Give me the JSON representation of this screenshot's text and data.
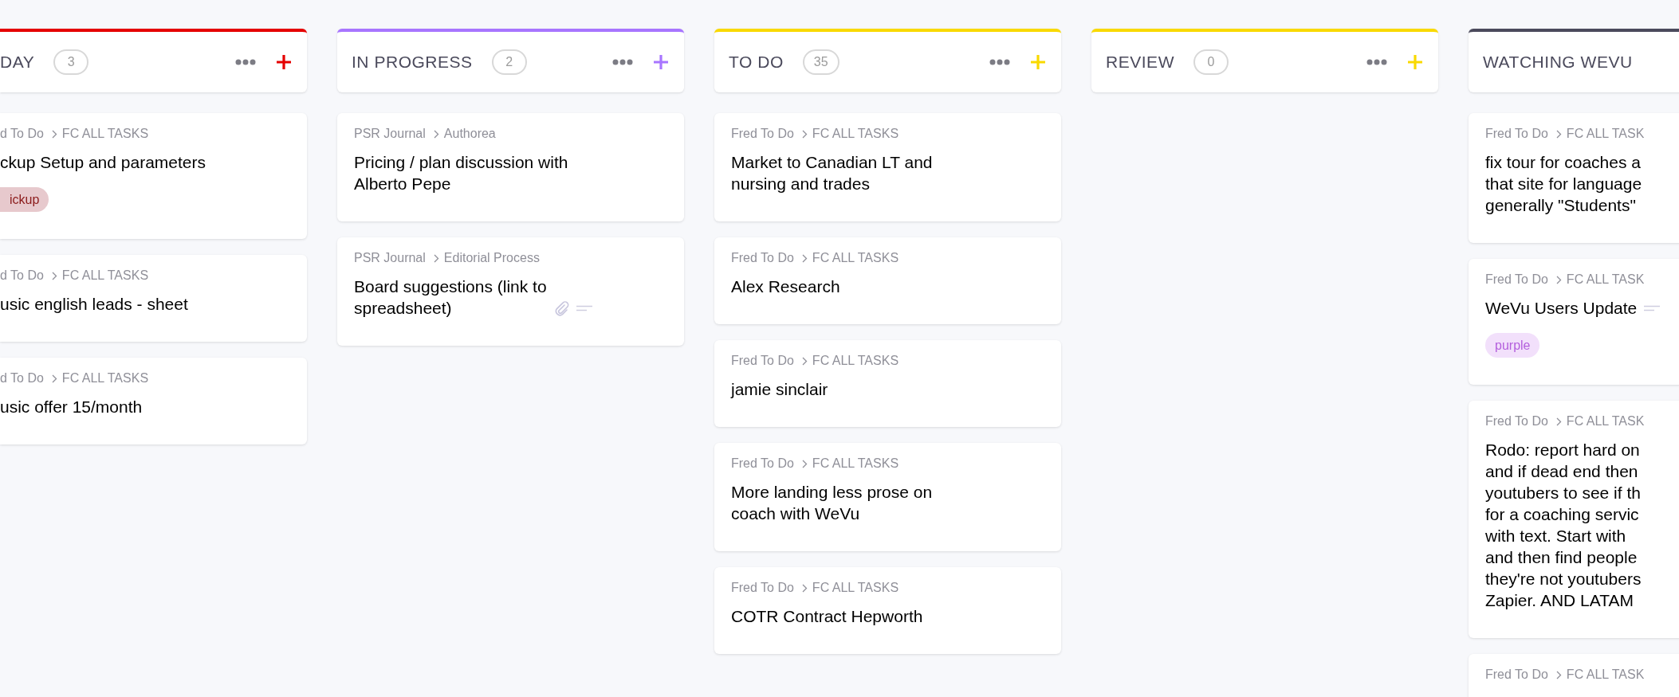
{
  "columns": [
    {
      "kind": "cut_left",
      "title": "DAY",
      "count": "3",
      "color": "#e50000",
      "actions": true,
      "cards": [
        {
          "breadcrumb": {
            "list": "d To Do",
            "folder": "FC ALL TASKS"
          },
          "title": "ckup Setup and parameters",
          "tags": [
            {
              "label": "ickup",
              "color": "#e7c9cd"
            }
          ]
        },
        {
          "breadcrumb": {
            "list": "d To Do",
            "folder": "FC ALL TASKS"
          },
          "title": "usic english leads - sheet"
        },
        {
          "breadcrumb": {
            "list": "d To Do",
            "folder": "FC ALL TASKS"
          },
          "title": "usic offer 15/month"
        }
      ]
    },
    {
      "kind": "full",
      "title": "IN PROGRESS",
      "count": "2",
      "color": "#a875ff",
      "actions": true,
      "cards": [
        {
          "breadcrumb": {
            "list": "PSR Journal",
            "folder": "Authorea"
          },
          "title": "Pricing / plan discussion with\nAlberto Pepe"
        },
        {
          "breadcrumb": {
            "list": "PSR Journal",
            "folder": "Editorial Process"
          },
          "title": "Board suggestions (link to\nspreadsheet)",
          "attachment": true,
          "description": true
        }
      ]
    },
    {
      "kind": "full",
      "title": "TO DO",
      "count": "35",
      "color": "#f9d900",
      "actions": true,
      "cards": [
        {
          "breadcrumb": {
            "list": "Fred To Do",
            "folder": "FC ALL TASKS"
          },
          "title": "Market to Canadian LT and\nnursing and trades"
        },
        {
          "breadcrumb": {
            "list": "Fred To Do",
            "folder": "FC ALL TASKS"
          },
          "title": "Alex Research"
        },
        {
          "breadcrumb": {
            "list": "Fred To Do",
            "folder": "FC ALL TASKS"
          },
          "title": "jamie sinclair"
        },
        {
          "breadcrumb": {
            "list": "Fred To Do",
            "folder": "FC ALL TASKS"
          },
          "title": "More landing less prose on\ncoach with WeVu"
        },
        {
          "breadcrumb": {
            "list": "Fred To Do",
            "folder": "FC ALL TASKS"
          },
          "title": "COTR Contract Hepworth"
        }
      ]
    },
    {
      "kind": "full",
      "title": "REVIEW",
      "count": "0",
      "color": "#f9d900",
      "actions": true
    },
    {
      "kind": "cut_right",
      "title": "WATCHING WEVU",
      "color": "#4b4a5c",
      "actions": false,
      "cards": [
        {
          "breadcrumb": {
            "list": "Fred To Do",
            "folder": "FC ALL TASK"
          },
          "title": "fix tour for coaches a\nthat site for language\ngenerally \"Students\""
        },
        {
          "breadcrumb": {
            "list": "Fred To Do",
            "folder": "FC ALL TASK"
          },
          "title": "WeVu Users Update",
          "tags": [
            {
              "label": "purple",
              "color": "#f2e0fb"
            }
          ],
          "description": true
        },
        {
          "breadcrumb": {
            "list": "Fred To Do",
            "folder": "FC ALL TASK"
          },
          "title": "Rodo: report hard on\nand if dead end then\nyoutubers to see if th\nfor a coaching servic\nwith text. Start with\nand then find people\nthey're not youtubers\nZapier. AND LATAM"
        },
        {
          "breadcrumb": {
            "list": "Fred To Do",
            "folder": "FC ALL TASK"
          }
        }
      ]
    }
  ]
}
